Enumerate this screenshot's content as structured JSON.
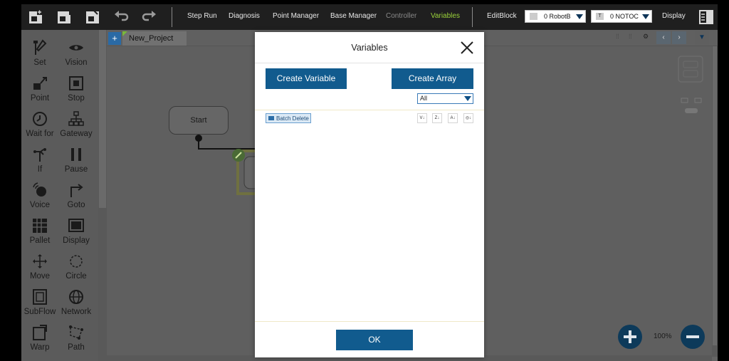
{
  "toolbar": {
    "menu": {
      "step_run": "Step Run",
      "diagnosis": "Diagnosis",
      "point_manager": "Point Manager",
      "base_manager": "Base Manager",
      "controller": "Controller",
      "variables": "Variables",
      "edit_block": "EditBlock",
      "display": "Display"
    },
    "robot_base_select": "0 RobotB",
    "tool_select": "0 NOTOC",
    "tool_tag": "T",
    "active_color": "#9bd33a"
  },
  "tools": [
    {
      "label": "Set",
      "icon": "wrench-icon"
    },
    {
      "label": "Vision",
      "icon": "eye-icon"
    },
    {
      "label": "Point",
      "icon": "point-icon"
    },
    {
      "label": "Stop",
      "icon": "stop-icon"
    },
    {
      "label": "Wait for",
      "icon": "clock-icon"
    },
    {
      "label": "Gateway",
      "icon": "gateway-icon"
    },
    {
      "label": "If",
      "icon": "if-icon"
    },
    {
      "label": "Pause",
      "icon": "pause-icon"
    },
    {
      "label": "Voice",
      "icon": "voice-icon"
    },
    {
      "label": "Goto",
      "icon": "goto-icon"
    },
    {
      "label": "Pallet",
      "icon": "pallet-icon"
    },
    {
      "label": "Display",
      "icon": "display-icon"
    },
    {
      "label": "Move",
      "icon": "move-icon"
    },
    {
      "label": "Circle",
      "icon": "circle-icon"
    },
    {
      "label": "SubFlow",
      "icon": "subflow-icon"
    },
    {
      "label": "Network",
      "icon": "globe-icon"
    },
    {
      "label": "Warp",
      "icon": "warp-icon"
    },
    {
      "label": "Path",
      "icon": "path-icon"
    }
  ],
  "project": {
    "tab_name": "New_Project",
    "start_node": "Start",
    "zoom": "100%"
  },
  "variables_dialog": {
    "title": "Variables",
    "create_variable": "Create Variable",
    "create_array": "Create Array",
    "filter_value": "All",
    "batch_delete": "Batch Delete",
    "sort_icons": [
      "Val",
      "Type",
      "A-Z",
      "Scope"
    ],
    "ok": "OK",
    "accent": "#115b8e"
  }
}
